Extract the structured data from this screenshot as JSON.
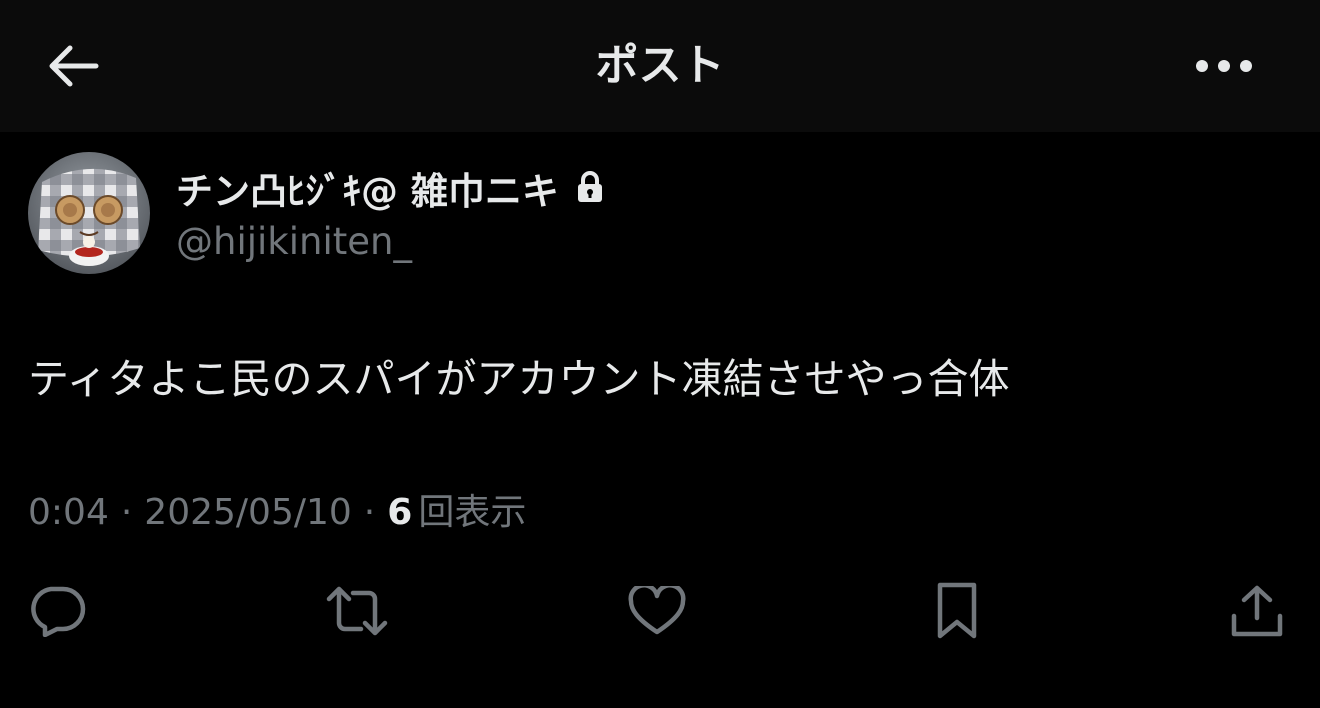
{
  "header": {
    "title": "ポスト",
    "back_icon": "arrow-left-icon",
    "more_icon": "more-horizontal-icon"
  },
  "author": {
    "display_name": "チン凸ﾋｼﾞｷ@ 雑巾ニキ",
    "handle": "@hijikiniten_",
    "protected_icon": "lock-icon"
  },
  "post": {
    "text": "ティタよこ民のスパイがアカウント凍結させやっ合体",
    "time": "0:04",
    "date": "2025/05/10",
    "separator": "·",
    "views_count": "6",
    "views_label": "回表示"
  },
  "actions": [
    {
      "name": "reply",
      "icon": "reply-icon"
    },
    {
      "name": "repost",
      "icon": "repost-icon"
    },
    {
      "name": "like",
      "icon": "heart-icon"
    },
    {
      "name": "bookmark",
      "icon": "bookmark-icon"
    },
    {
      "name": "share",
      "icon": "share-icon"
    }
  ],
  "colors": {
    "background": "#000000",
    "header_background": "#0b0b0b",
    "primary_text": "#e7e9ea",
    "secondary_text": "#71767b"
  }
}
